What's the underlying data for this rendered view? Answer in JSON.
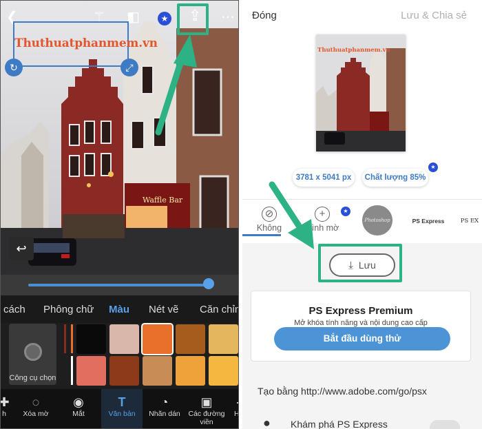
{
  "left": {
    "watermark_text": "Thuthuatphanmem.vn",
    "tabs": [
      "cách",
      "Phông chữ",
      "Màu",
      "Nét vẽ",
      "Căn chỉnh"
    ],
    "active_tab": "Màu",
    "tool_label": "Công cụ chọn",
    "swatches": [
      "#0a0a0a",
      "#d9b8ab",
      "#e8702a",
      "#a65c1c",
      "#e4b65e",
      "#e26e60",
      "#8c3a19",
      "#c88d57",
      "#f0a23a",
      "#f4b840"
    ],
    "selected_swatch": 2,
    "nav": [
      {
        "label": "h",
        "icon": "bandage-icon"
      },
      {
        "label": "Xóa mờ",
        "icon": "blur-icon"
      },
      {
        "label": "Mắt",
        "icon": "eye-icon"
      },
      {
        "label": "Văn bản",
        "icon": "text-icon"
      },
      {
        "label": "Nhãn dán",
        "icon": "sticker-icon"
      },
      {
        "label": "Các đường viền",
        "icon": "border-icon"
      },
      {
        "label": "Hi",
        "icon": "more-icon"
      }
    ],
    "active_nav": "Văn bản",
    "slider_value": 1.0
  },
  "right": {
    "done": "Đóng",
    "save_share": "Lưu & Chia sẻ",
    "thumb_watermark": "Thuthuatphanmem.vn",
    "dimensions": "3781 x 5041 px",
    "quality": "Chất lượng 85%",
    "watermark_options": [
      {
        "label": "Không",
        "icon": "no-watermark-icon"
      },
      {
        "label": "Hình mờ",
        "icon": "add-watermark-icon"
      },
      {
        "label": "Photoshop Express",
        "icon": "ps-express-seal"
      },
      {
        "label": "PS Express",
        "icon": "ps-express-logo"
      },
      {
        "label": "PS EX",
        "icon": "ps-express-logo"
      }
    ],
    "save_label": "Lưu",
    "premium_title": "PS Express Premium",
    "premium_sub": "Mở khóa tính năng và nội dung cao cấp",
    "premium_button": "Bắt đầu dùng thử",
    "created_with": "Tạo bằng http://www.adobe.com/go/psx",
    "explore": "Khám phá PS Express"
  },
  "colors": {
    "accent_blue": "#3f7ac4",
    "highlight_green": "#2db286",
    "watermark_orange": "#e2572e"
  }
}
